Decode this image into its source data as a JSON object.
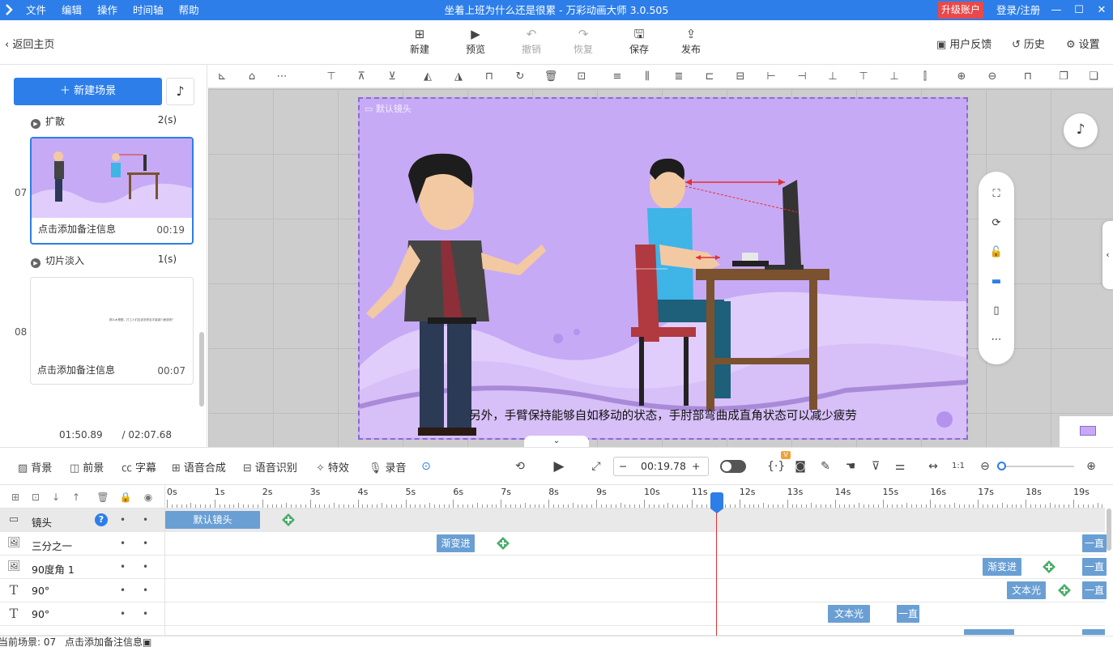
{
  "app": {
    "title": "坐着上班为什么还是很累 - 万彩动画大师 3.0.505",
    "menu": [
      "文件",
      "编辑",
      "操作",
      "时间轴",
      "帮助"
    ],
    "upgrade": "升级账户",
    "login": "登录/注册"
  },
  "toolbar": {
    "back": "返回主页",
    "buttons": [
      {
        "label": "新建",
        "icon": "plus-square-icon",
        "disabled": false
      },
      {
        "label": "预览",
        "icon": "play-icon",
        "disabled": false
      },
      {
        "label": "撤销",
        "icon": "undo-icon",
        "disabled": true
      },
      {
        "label": "恢复",
        "icon": "redo-icon",
        "disabled": true
      },
      {
        "label": "保存",
        "icon": "save-icon",
        "disabled": false
      },
      {
        "label": "发布",
        "icon": "publish-icon",
        "disabled": false
      }
    ],
    "feedback": "用户反馈",
    "history": "历史",
    "settings": "设置"
  },
  "scenes": {
    "new_scene": "新建场景",
    "transitions": [
      {
        "name": "扩散",
        "duration": "2(s)"
      },
      {
        "name": "切片淡入",
        "duration": "1(s)"
      }
    ],
    "items": [
      {
        "number": "07",
        "note": "点击添加备注信息",
        "duration": "00:19",
        "active": true
      },
      {
        "number": "08",
        "note": "点击添加备注信息",
        "duration": "00:07",
        "active": false
      }
    ],
    "time_current": "01:50.89",
    "time_total": "/ 02:07.68"
  },
  "stage": {
    "camera_label": "默认镜头",
    "subtitle": "另外，手臂保持能够自如移动的状态，手肘部弯曲成直角状态可以减少疲劳",
    "thumb8_text": "那么木是额，打工人们应该怎样坐才能减少疲劳呢？",
    "colors": {
      "background": "#c7aaf5",
      "wave": "#e0cdfb",
      "accent": "#2d7ee9"
    }
  },
  "timeline_tools": {
    "items": [
      "背景",
      "前景",
      "字幕",
      "语音合成",
      "语音识别",
      "特效",
      "录音"
    ],
    "current_time": "00:19.78",
    "vip": "V"
  },
  "timeline": {
    "ticks": [
      "0s",
      "1s",
      "2s",
      "3s",
      "4s",
      "5s",
      "6s",
      "7s",
      "8s",
      "9s",
      "10s",
      "11s",
      "12s",
      "13s",
      "14s",
      "15s",
      "16s",
      "17s",
      "18s",
      "19s"
    ],
    "rows": [
      {
        "name": "镜头",
        "icon": "camera-icon"
      },
      {
        "name": "三分之一",
        "icon": "image-icon"
      },
      {
        "name": "90度角 1",
        "icon": "image-icon"
      },
      {
        "name": "90°",
        "icon": "text-icon"
      },
      {
        "name": "90°",
        "icon": "text-icon"
      }
    ],
    "clips": {
      "camera": "默认镜头",
      "fade_in_1": "渐变进",
      "always_1": "一直",
      "fade_in_2": "渐变进",
      "always_2": "一直",
      "text_light_1": "文本光",
      "always_3": "一直",
      "text_light_2": "文本光",
      "always_4": "一直"
    }
  },
  "status": {
    "scene": "当前场景: 07",
    "note": "点击添加备注信息"
  }
}
